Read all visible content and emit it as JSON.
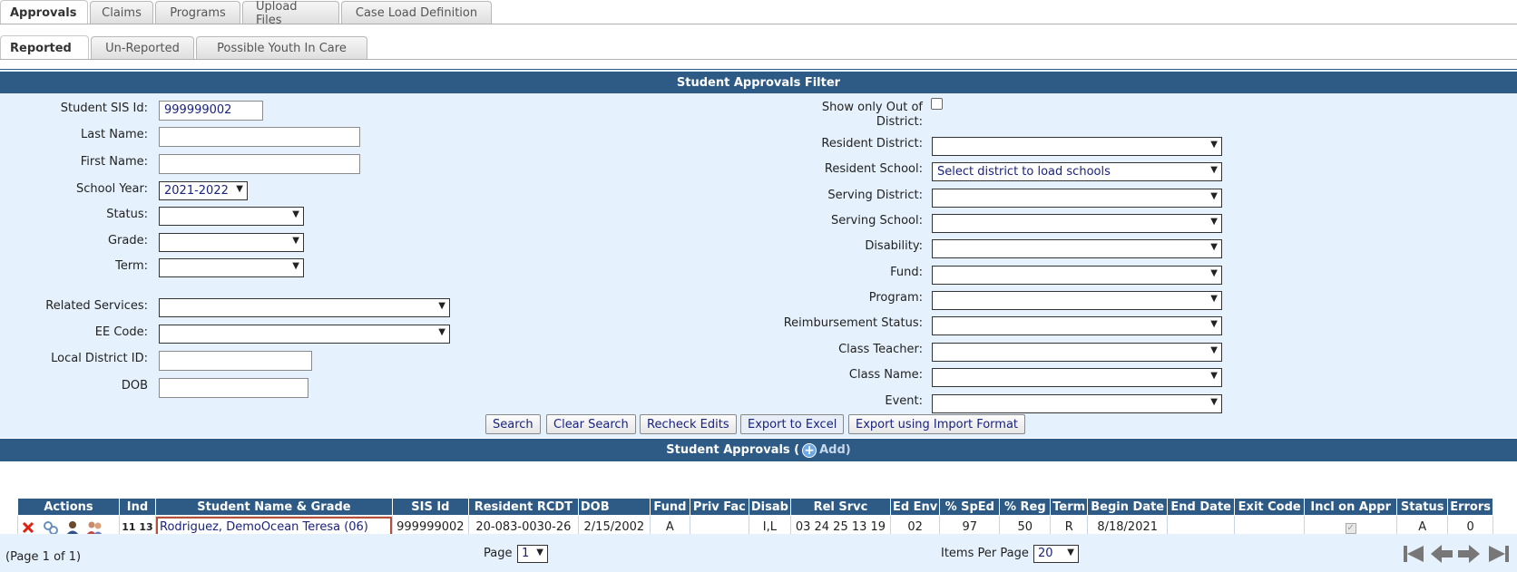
{
  "tabs_main": [
    "Approvals",
    "Claims",
    "Programs",
    "Upload Files",
    "Case Load Definition"
  ],
  "tabs_sub": [
    "Reported",
    "Un-Reported",
    "Possible Youth In Care"
  ],
  "filter": {
    "title": "Student Approvals Filter",
    "left": {
      "sis_id_label": "Student SIS Id:",
      "sis_id_value": "999999002",
      "last_name_label": "Last Name:",
      "first_name_label": "First Name:",
      "school_year_label": "School Year:",
      "school_year_value": "2021-2022",
      "status_label": "Status:",
      "grade_label": "Grade:",
      "term_label": "Term:",
      "related_label": "Related Services:",
      "ee_label": "EE Code:",
      "local_label": "Local District ID:",
      "dob_label": "DOB"
    },
    "right": {
      "ood_label": "Show only Out of District:",
      "resident_district": "Resident District:",
      "resident_school": "Resident School:",
      "resident_school_value": "Select district to load schools",
      "serving_district": "Serving District:",
      "serving_school": "Serving School:",
      "disability": "Disability:",
      "fund": "Fund:",
      "program": "Program:",
      "reimb": "Reimbursement Status:",
      "teacher": "Class Teacher:",
      "classname": "Class Name:",
      "event": "Event:"
    },
    "buttons": {
      "search": "Search",
      "clear": "Clear Search",
      "recheck": "Recheck Edits",
      "excel": "Export to Excel",
      "import": "Export using Import Format"
    }
  },
  "approvals": {
    "title": "Student Approvals (",
    "add": "Add)",
    "columns": [
      "Actions",
      "Ind",
      "Student Name & Grade",
      "SIS Id",
      "Resident RCDT",
      "DOB",
      "Fund",
      "Priv Fac",
      "Disab",
      "Rel Srvc",
      "Ed Env",
      "% SpEd",
      "% Reg",
      "Term",
      "Begin Date",
      "End Date",
      "Exit Code",
      "Incl on Appr",
      "Status",
      "Errors"
    ],
    "row": {
      "ind": "11 13",
      "name": "Rodriguez, DemoOcean Teresa (06)",
      "sis": "999999002",
      "rcdt": "20-083-0030-26",
      "dob": "2/15/2002",
      "fund": "A",
      "privfac": "",
      "disab": "I,L",
      "relsrvc": "03 24 25 13 19",
      "edenv": "02",
      "sped": "97",
      "reg": "50",
      "term": "R",
      "begin": "8/18/2021",
      "end": "",
      "exit": "",
      "status": "A",
      "errors": "0"
    }
  },
  "pager": {
    "page_info": "(Page 1 of 1)",
    "page_label": "Page",
    "page_value": "1",
    "items_label": "Items Per Page",
    "items_value": "20"
  },
  "colors": {
    "header_blue": "#2e5b86",
    "panel_bg": "#e5f1fc",
    "link": "#1a237e",
    "highlight": "#b5503a"
  }
}
